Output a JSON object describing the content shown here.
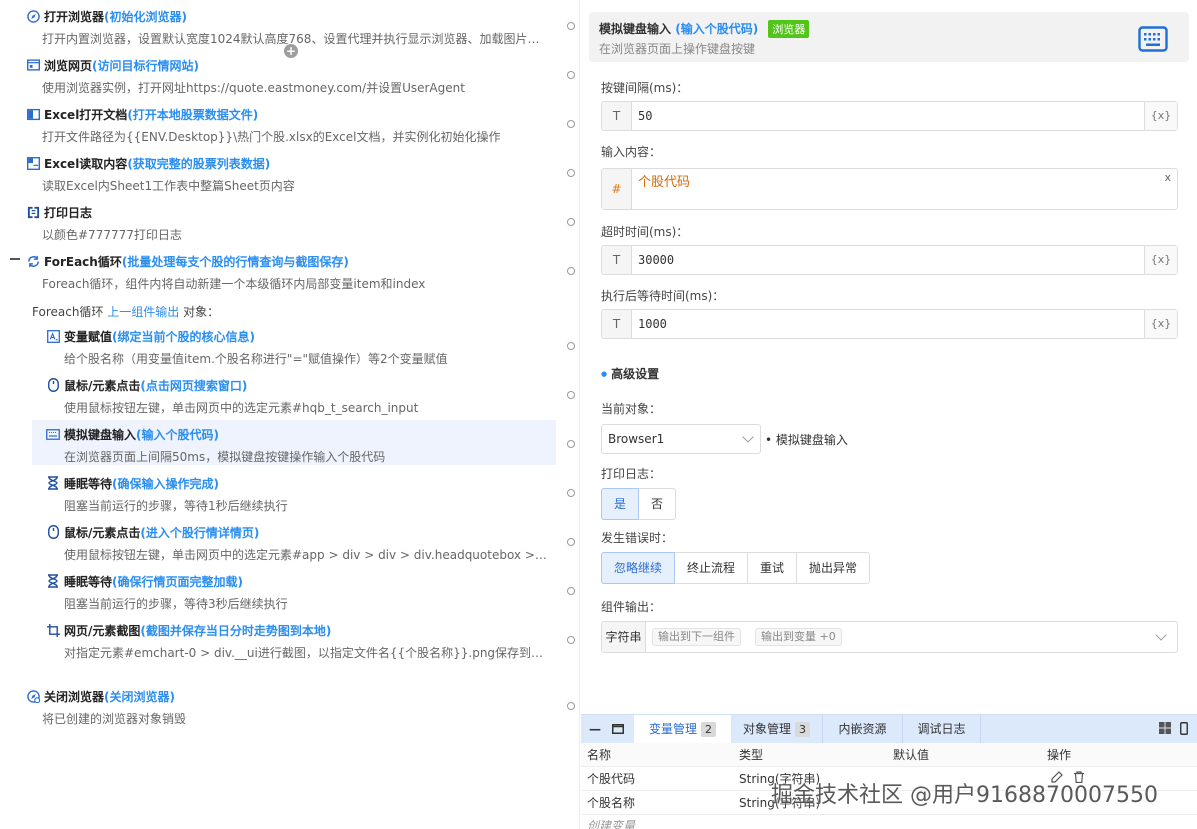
{
  "steps": [
    {
      "name": "打开浏览器",
      "tag": "(初始化浏览器)",
      "desc": "打开内置浏览器，设置默认宽度1024默认高度768、设置代理并执行显示浏览器、加载图片、...",
      "icon": "browser-compass-icon"
    },
    {
      "name": "浏览网页",
      "tag": "(访问目标行情网站)",
      "desc": "使用浏览器实例，打开网址https://quote.eastmoney.com/并设置UserAgent",
      "icon": "web-page-icon"
    },
    {
      "name": "Excel打开文档",
      "tag": "(打开本地股票数据文件)",
      "desc": "打开文件路径为{{ENV.Desktop}}\\热门个股.xlsx的Excel文档，并实例化初始化操作",
      "icon": "excel-book-icon"
    },
    {
      "name": "Excel读取内容",
      "tag": "(获取完整的股票列表数据)",
      "desc": "读取Excel内Sheet1工作表中整篇Sheet页内容",
      "icon": "excel-read-icon"
    },
    {
      "name": "打印日志",
      "tag": "",
      "desc": "以颜色#777777打印日志",
      "icon": "print-log-icon"
    },
    {
      "name": "ForEach循环",
      "tag": " (批量处理每支个股的行情查询与截图保存)",
      "desc": "Foreach循环，组件内将自动新建一个本级循环内局部变量item和index",
      "icon": "loop-icon"
    },
    {
      "name": "变量赋值",
      "tag": "(绑定当前个股的核心信息)",
      "desc": "给个股名称（用变量值item.个股名称进行\"=\"赋值操作）等2个变量赋值",
      "icon": "variable-assign-icon"
    },
    {
      "name": "鼠标/元素点击",
      "tag": "(点击网页搜索窗口)",
      "desc": "使用鼠标按钮左键，单击网页中的选定元素#hqb_t_search_input",
      "icon": "mouse-icon"
    },
    {
      "name": "模拟键盘输入",
      "tag": "(输入个股代码)",
      "desc": "在浏览器页面上间隔50ms，模拟键盘按键操作输入个股代码",
      "icon": "keyboard-icon"
    },
    {
      "name": "睡眠等待",
      "tag": "(确保输入操作完成)",
      "desc": "阻塞当前运行的步骤，等待1秒后继续执行",
      "icon": "hourglass-icon"
    },
    {
      "name": "鼠标/元素点击",
      "tag": "(进入个股行情详情页)",
      "desc": "使用鼠标按钮左键，单击网页中的选定元素#app > div > div > div.headquotebox > div.hqb...",
      "icon": "mouse-icon"
    },
    {
      "name": "睡眠等待",
      "tag": "(确保行情页面完整加载)",
      "desc": "阻塞当前运行的步骤，等待3秒后继续执行",
      "icon": "hourglass-icon"
    },
    {
      "name": "网页/元素截图",
      "tag": "(截图并保存当日分时走势图到本地)",
      "desc": "对指定元素#emchart-0 > div.__ui进行截图，以指定文件名{{个股名称}}.png保存到文件夹{{...",
      "icon": "crop-icon"
    },
    {
      "name": "关闭浏览器",
      "tag": "(关闭浏览器)",
      "desc": "将已创建的浏览器对象销毁",
      "icon": "browser-close-icon"
    }
  ],
  "foreach": {
    "prefix": "Foreach循环",
    "link": "上一组件输出",
    "suffix": "对象："
  },
  "panel": {
    "title": "模拟键盘输入",
    "subtitle": "(输入个股代码)",
    "badge": "浏览器",
    "desc": "在浏览器页面上操作键盘按键",
    "interval_label": "按键间隔(ms)：",
    "interval_value": "50",
    "input_label": "输入内容：",
    "input_value": "个股代码",
    "timeout_label": "超时时间(ms)：",
    "timeout_value": "30000",
    "wait_label": "执行后等待时间(ms)：",
    "wait_value": "1000",
    "text_prefix": "T",
    "expr_prefix": "#",
    "var_button": "{x}",
    "clear": "x",
    "advanced": "高级设置",
    "object_label": "当前对象：",
    "object_value": "Browser1",
    "object_side": "• 模拟键盘输入",
    "log_label": "打印日志：",
    "log_options": [
      "是",
      "否"
    ],
    "error_label": "发生错误时：",
    "error_options": [
      "忽略继续",
      "终止流程",
      "重试",
      "抛出异常"
    ],
    "output_label": "组件输出：",
    "output_type": "字符串",
    "output_chip1": "输出到下一组件",
    "output_chip2": "输出到变量 +0"
  },
  "bottom": {
    "tabs": [
      {
        "label": "变量管理",
        "count": "2"
      },
      {
        "label": "对象管理",
        "count": "3"
      },
      {
        "label": "内嵌资源",
        "count": ""
      },
      {
        "label": "调试日志",
        "count": ""
      }
    ],
    "columns": [
      "名称",
      "类型",
      "默认值",
      "操作"
    ],
    "rows": [
      {
        "name": "个股代码",
        "type": "String(字符串)"
      },
      {
        "name": "个股名称",
        "type": "String(字符串)"
      }
    ],
    "create": "创建变量",
    "watermark": "掘金技术社区 @用户9168870007550"
  },
  "colors": {
    "accent": "#2b8ef0",
    "badge": "#52c41a",
    "tabbar": "#dbe9fb",
    "selected_row": "#eef3fd"
  }
}
